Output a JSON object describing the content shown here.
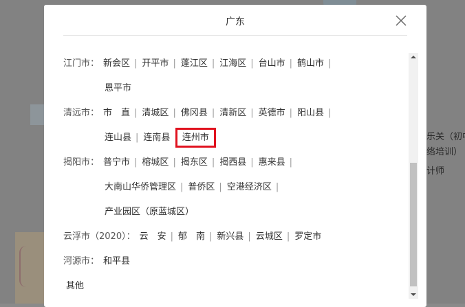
{
  "background": {
    "text_lines": [
      "乐关（初中",
      "络培训）",
      "计师"
    ]
  },
  "modal": {
    "title": "广东",
    "rows": [
      {
        "city": "江门市：",
        "items": [
          "新会区",
          "开平市",
          "蓬江区",
          "江海区",
          "台山市",
          "鹤山市"
        ],
        "trailing_sep": true
      },
      {
        "city": "",
        "items": [
          "恩平市"
        ],
        "trailing_sep": false
      },
      {
        "city": "清远市：",
        "items": [
          "市　直",
          "清城区",
          "佛冈县",
          "清新区",
          "英德市",
          "阳山县"
        ],
        "trailing_sep": true
      },
      {
        "city": "",
        "items": [
          "连山县",
          "连南县",
          "连州市"
        ],
        "trailing_sep": false
      },
      {
        "city": "揭阳市：",
        "items": [
          "普宁市",
          "榕城区",
          "揭东区",
          "揭西县",
          "惠来县"
        ],
        "trailing_sep": true
      },
      {
        "city": "",
        "items": [
          "大南山华侨管理区",
          "普侨区",
          "空港经济区"
        ],
        "trailing_sep": true
      },
      {
        "city": "",
        "items": [
          "产业园区（原蓝城区）"
        ],
        "trailing_sep": false
      },
      {
        "city": "云浮市（2020）：",
        "items": [
          "云　安",
          "郁　南",
          "新兴县",
          "云城区",
          "罗定市"
        ],
        "trailing_sep": false
      },
      {
        "city": "河源市：",
        "items": [
          "和平县"
        ],
        "trailing_sep": false
      },
      {
        "city": "",
        "items": [
          "其他"
        ],
        "trailing_sep": false,
        "offset_left": true
      }
    ],
    "highlighted_item": "连州市",
    "highlight_color": "#e0121f"
  }
}
